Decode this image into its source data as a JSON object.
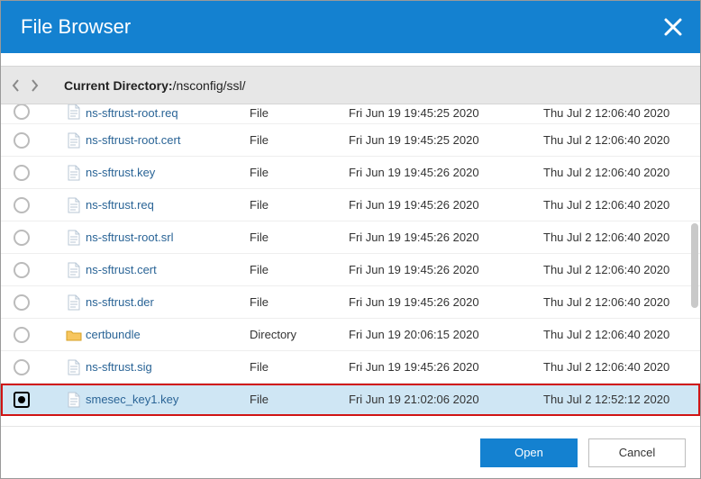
{
  "title": "File Browser",
  "breadcrumb": {
    "label": "Current Directory: ",
    "path": "/nsconfig/ssl/"
  },
  "partial_top_row": {
    "name": "ns-sftrust-root.req",
    "type": "File",
    "created": "Fri Jun 19 19:45:25 2020",
    "modified": "Thu Jul  2 12:06:40 2020"
  },
  "rows": [
    {
      "name": "ns-sftrust-root.cert",
      "type": "File",
      "icon": "file",
      "created": "Fri Jun 19 19:45:25 2020",
      "modified": "Thu Jul  2 12:06:40 2020",
      "selected": false
    },
    {
      "name": "ns-sftrust.key",
      "type": "File",
      "icon": "file",
      "created": "Fri Jun 19 19:45:26 2020",
      "modified": "Thu Jul  2 12:06:40 2020",
      "selected": false
    },
    {
      "name": "ns-sftrust.req",
      "type": "File",
      "icon": "file",
      "created": "Fri Jun 19 19:45:26 2020",
      "modified": "Thu Jul  2 12:06:40 2020",
      "selected": false
    },
    {
      "name": "ns-sftrust-root.srl",
      "type": "File",
      "icon": "file",
      "created": "Fri Jun 19 19:45:26 2020",
      "modified": "Thu Jul  2 12:06:40 2020",
      "selected": false
    },
    {
      "name": "ns-sftrust.cert",
      "type": "File",
      "icon": "file",
      "created": "Fri Jun 19 19:45:26 2020",
      "modified": "Thu Jul  2 12:06:40 2020",
      "selected": false
    },
    {
      "name": "ns-sftrust.der",
      "type": "File",
      "icon": "file",
      "created": "Fri Jun 19 19:45:26 2020",
      "modified": "Thu Jul  2 12:06:40 2020",
      "selected": false
    },
    {
      "name": "certbundle",
      "type": "Directory",
      "icon": "folder",
      "created": "Fri Jun 19 20:06:15 2020",
      "modified": "Thu Jul  2 12:06:40 2020",
      "selected": false
    },
    {
      "name": "ns-sftrust.sig",
      "type": "File",
      "icon": "file",
      "created": "Fri Jun 19 19:45:26 2020",
      "modified": "Thu Jul  2 12:06:40 2020",
      "selected": false
    },
    {
      "name": "smesec_key1.key",
      "type": "File",
      "icon": "file",
      "created": "Fri Jun 19 21:02:06 2020",
      "modified": "Thu Jul  2 12:52:12 2020",
      "selected": true
    }
  ],
  "footer": {
    "open": "Open",
    "cancel": "Cancel"
  }
}
